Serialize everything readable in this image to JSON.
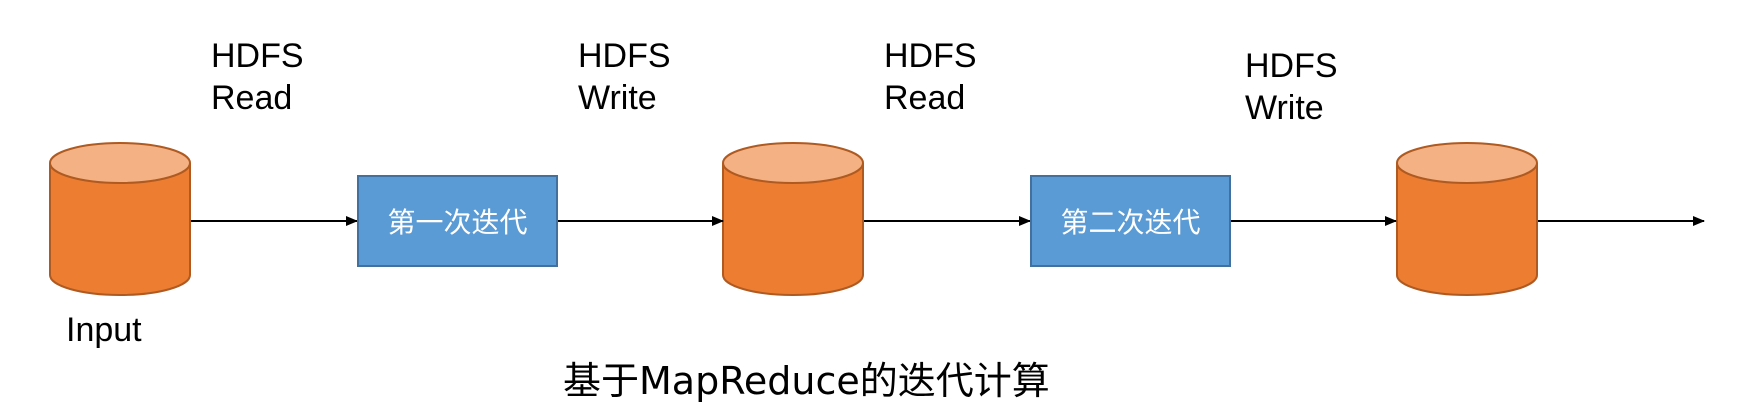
{
  "colors": {
    "storage_fill": "#ed7d31",
    "storage_top": "#f4b183",
    "storage_stroke": "#ae5a21",
    "step_fill": "#5b9bd5",
    "step_stroke": "#41719c",
    "arrow": "#000000"
  },
  "labels": {
    "read_1": {
      "line1": "HDFS",
      "line2": "Read"
    },
    "write_1": {
      "line1": "HDFS",
      "line2": "Write"
    },
    "read_2": {
      "line1": "HDFS",
      "line2": "Read"
    },
    "write_2": {
      "line1": "HDFS",
      "line2": "Write"
    },
    "input": "Input"
  },
  "steps": {
    "first": "第一次迭代",
    "second": "第二次迭代"
  },
  "caption": "基于MapReduce的迭代计算"
}
